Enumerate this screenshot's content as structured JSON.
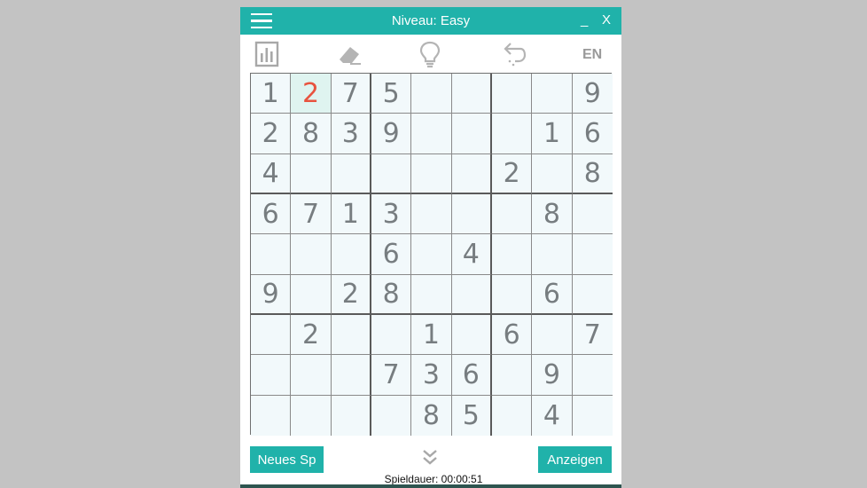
{
  "window": {
    "title": "Niveau: Easy",
    "minimize_label": "_",
    "close_label": "X"
  },
  "toolbar": {
    "stats_icon": "bar-chart-icon",
    "eraser_icon": "eraser-icon",
    "hint_icon": "lightbulb-icon",
    "undo_icon": "undo-icon",
    "language": "EN"
  },
  "board": {
    "cells": [
      [
        "1",
        "2",
        "7",
        "5",
        "",
        "",
        "",
        "",
        "9"
      ],
      [
        "2",
        "8",
        "3",
        "9",
        "",
        "",
        "",
        "1",
        "6"
      ],
      [
        "4",
        "",
        "",
        "",
        "",
        "",
        "2",
        "",
        "8"
      ],
      [
        "6",
        "7",
        "1",
        "3",
        "",
        "",
        "",
        "8",
        ""
      ],
      [
        "",
        "",
        "",
        "6",
        "",
        "4",
        "",
        "",
        ""
      ],
      [
        "9",
        "",
        "2",
        "8",
        "",
        "",
        "",
        "6",
        ""
      ],
      [
        "",
        "2",
        "",
        "",
        "1",
        "",
        "6",
        "",
        "7"
      ],
      [
        "",
        "",
        "",
        "7",
        "3",
        "6",
        "",
        "9",
        ""
      ],
      [
        "",
        "",
        "",
        "",
        "8",
        "5",
        "",
        "4",
        ""
      ]
    ],
    "selected": {
      "row": 0,
      "col": 1
    }
  },
  "footer": {
    "new_game_label": "Neues Sp",
    "show_label": "Anzeigen",
    "expand_icon": "double-chevron-down-icon",
    "duration_text": "Spieldauer: 00:00:51"
  },
  "colors": {
    "accent": "#20b2aa",
    "cell_bg": "#f2f9fb",
    "selected_bg": "#dff4f0",
    "selected_text": "#e8533f",
    "digit": "#777d80"
  }
}
